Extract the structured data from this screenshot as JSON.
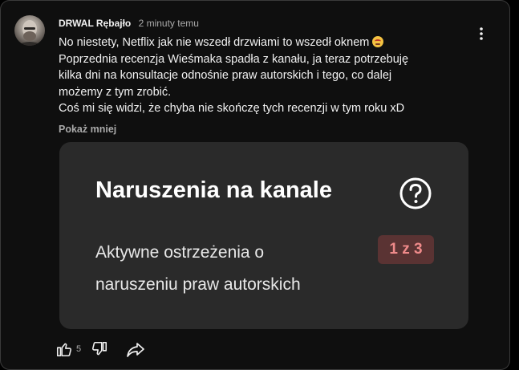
{
  "comment": {
    "author": "DRWAL Rębajło",
    "time": "2 minuty temu",
    "lines": [
      "No niestety, Netflix jak nie wszedł drzwiami to wszedł oknem",
      "Poprzednia recenzja Wieśmaka spadła z kanału, ja teraz potrzebuję",
      "kilka dni na konsultacje odnośnie praw autorskich i tego, co dalej",
      "możemy z tym zrobić.",
      "Coś mi się widzi, że chyba nie skończę tych recenzji w tym roku xD"
    ],
    "emoji": "dizzy-face-emoji",
    "show_less": "Pokaż mniej",
    "likes": "5"
  },
  "embedded": {
    "title": "Naruszenia na kanale",
    "text_lines": [
      "Aktywne ostrzeżenia o",
      "naruszeniu praw autorskich"
    ],
    "badge": "1 z 3",
    "badge_colors": {
      "background": "#5a3333",
      "text": "#ef8a8a"
    }
  },
  "icons": {
    "menu": "kebab-menu-icon",
    "help": "help-circle-icon",
    "like": "thumb-up-icon",
    "dislike": "thumb-down-icon",
    "share": "share-icon"
  }
}
